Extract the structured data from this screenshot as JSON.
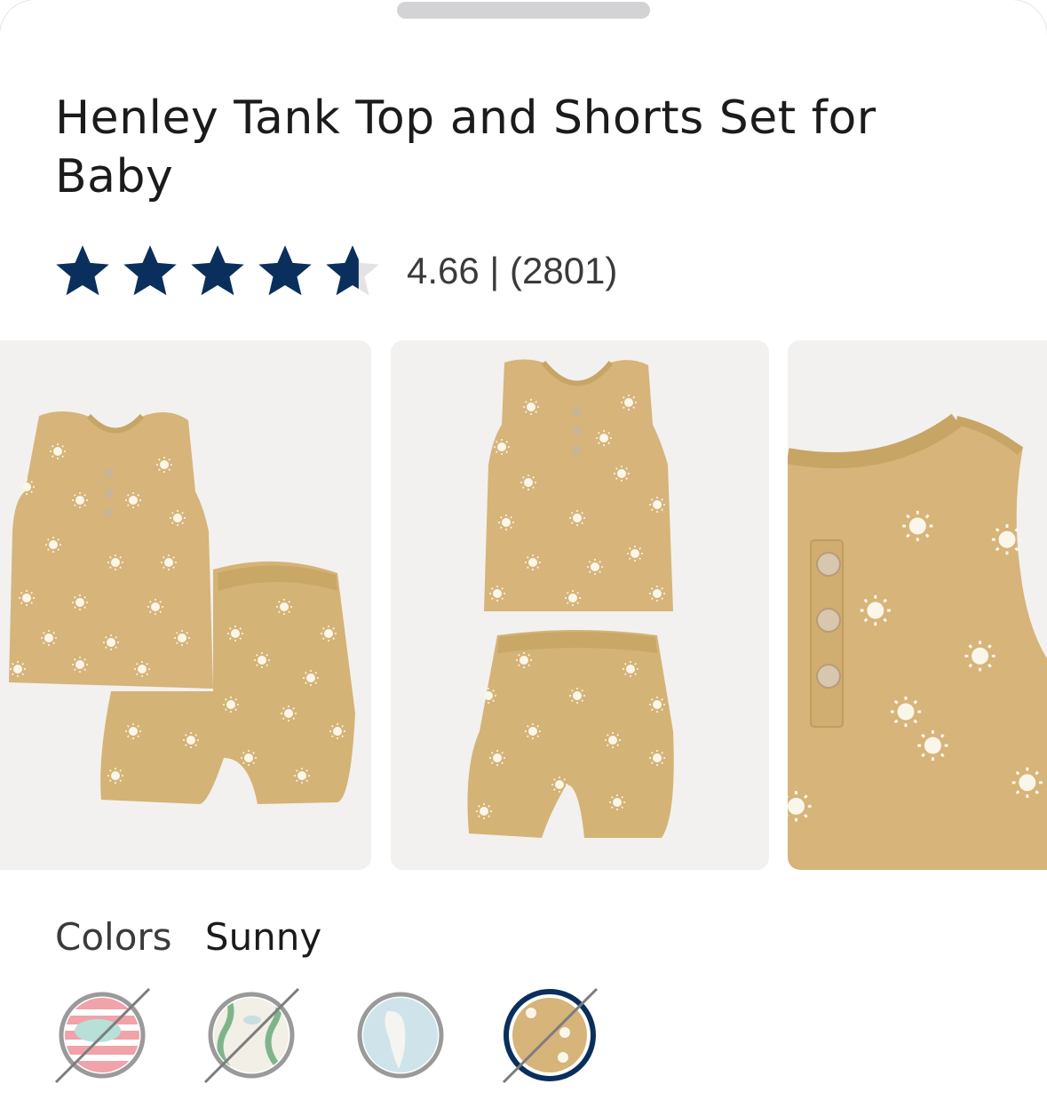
{
  "product": {
    "title": "Henley Tank Top and Shorts Set for Baby",
    "rating": 4.66,
    "rating_text": "4.66 | (2801)",
    "review_count": 2801
  },
  "gallery": {
    "images": [
      {
        "name": "flat-lay-set-overlapping"
      },
      {
        "name": "flat-lay-set-stacked"
      },
      {
        "name": "closeup-henley-neckline"
      }
    ]
  },
  "colors": {
    "label": "Colors",
    "selected": "Sunny",
    "swatches": [
      {
        "name": "red-stripe-whale",
        "available": false,
        "selected": false
      },
      {
        "name": "green-wave",
        "available": false,
        "selected": false
      },
      {
        "name": "blue-shark",
        "available": true,
        "selected": false
      },
      {
        "name": "sunny",
        "available": false,
        "selected": true
      }
    ]
  },
  "theme": {
    "star_color": "#0a2f5c",
    "fabric_color": "#d6b47a",
    "selected_ring": "#0a2f5c"
  }
}
